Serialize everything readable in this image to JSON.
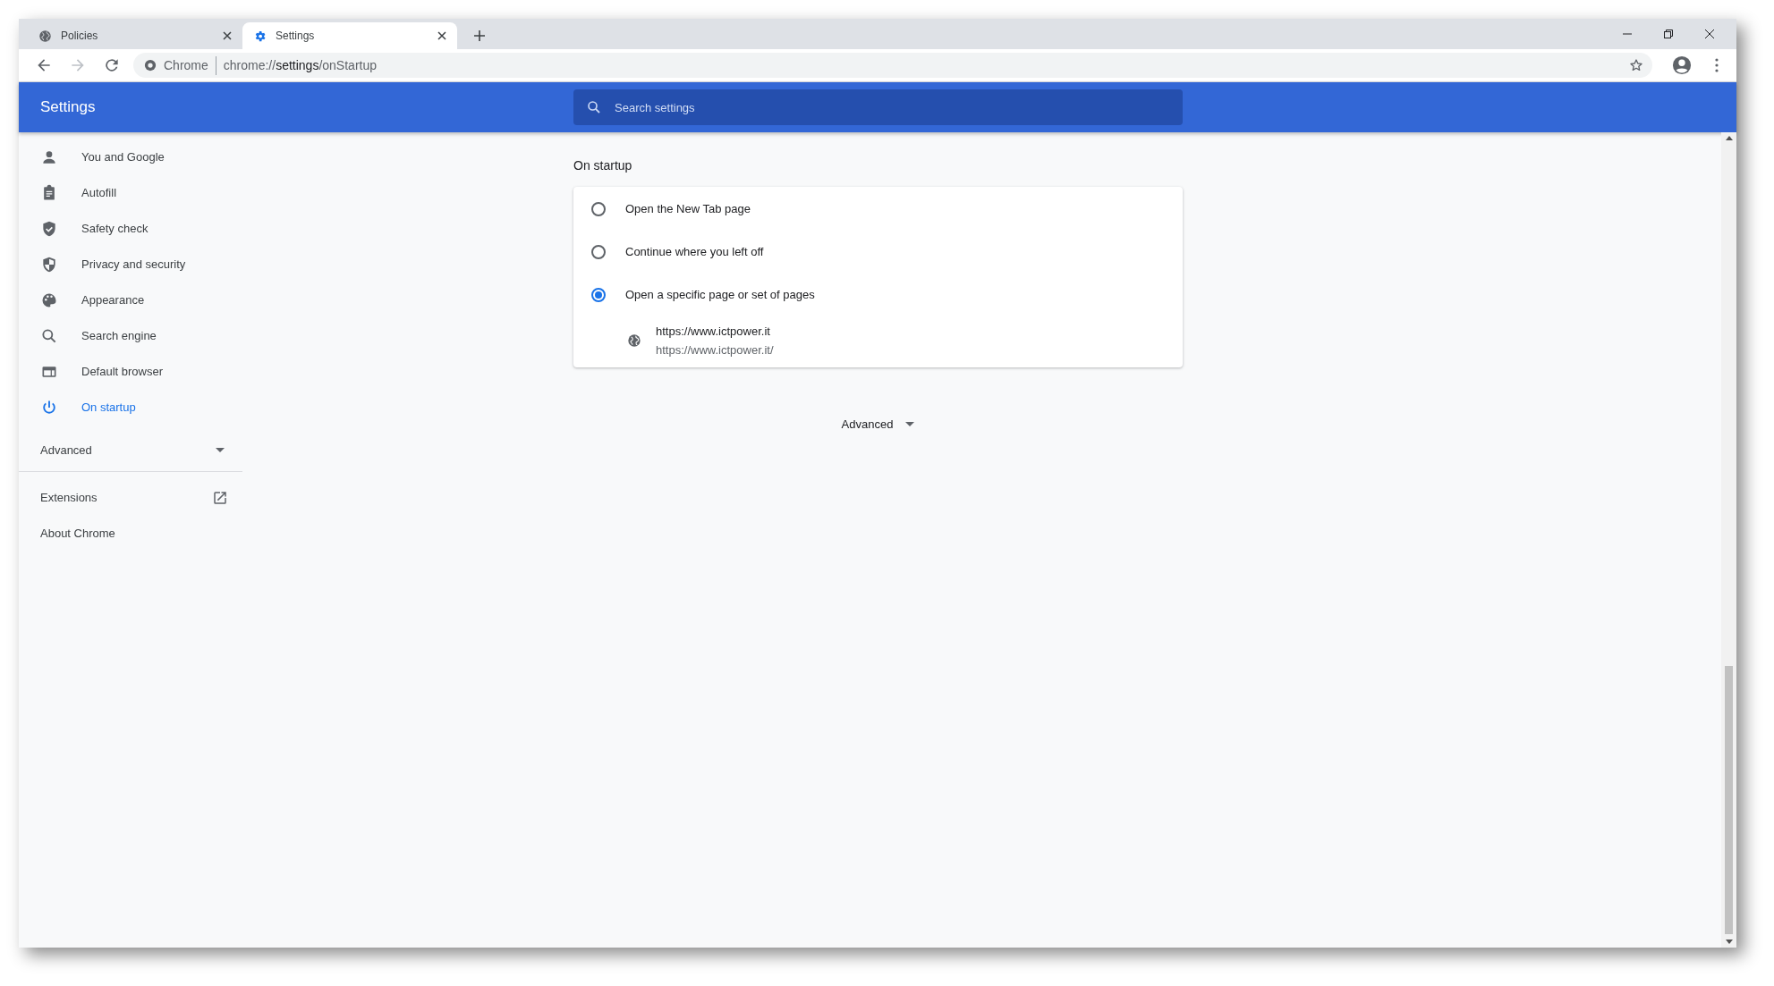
{
  "tabs": [
    {
      "title": "Policies",
      "selected": false
    },
    {
      "title": "Settings",
      "selected": true
    }
  ],
  "address_bar": {
    "site_label": "Chrome",
    "url_prefix": "chrome://",
    "url_host": "settings",
    "url_path": "/onStartup"
  },
  "header": {
    "title": "Settings",
    "search": {
      "placeholder": "Search settings"
    }
  },
  "sidebar": {
    "items": [
      {
        "label": "You and Google",
        "selected": false
      },
      {
        "label": "Autofill",
        "selected": false
      },
      {
        "label": "Safety check",
        "selected": false
      },
      {
        "label": "Privacy and security",
        "selected": false
      },
      {
        "label": "Appearance",
        "selected": false
      },
      {
        "label": "Search engine",
        "selected": false
      },
      {
        "label": "Default browser",
        "selected": false
      },
      {
        "label": "On startup",
        "selected": true
      }
    ],
    "advanced": {
      "label": "Advanced",
      "expanded": false
    },
    "links": [
      {
        "label": "Extensions",
        "kind": "external"
      },
      {
        "label": "About Chrome",
        "kind": "internal"
      }
    ]
  },
  "section": {
    "title": "On startup",
    "options": [
      {
        "label": "Open the New Tab page",
        "selected": false
      },
      {
        "label": "Continue where you left off",
        "selected": false
      },
      {
        "label": "Open a specific page or set of pages",
        "selected": true
      }
    ],
    "pages": [
      {
        "name": "https://www.ictpower.it",
        "url": "https://www.ictpower.it/"
      }
    ]
  },
  "advanced_button": {
    "label": "Advanced"
  }
}
